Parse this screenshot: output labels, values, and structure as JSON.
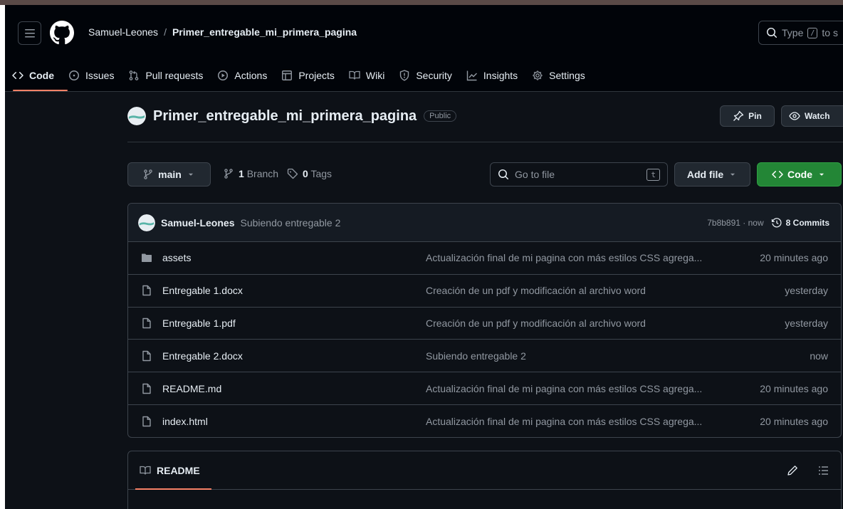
{
  "header": {
    "owner": "Samuel-Leones",
    "separator": "/",
    "repo": "Primer_entregable_mi_primera_pagina",
    "search_text": "Type",
    "search_kbd": "/",
    "search_suffix": "to s"
  },
  "nav": {
    "items": [
      {
        "label": "Code",
        "icon": "code-icon",
        "active": true
      },
      {
        "label": "Issues",
        "icon": "issue-icon"
      },
      {
        "label": "Pull requests",
        "icon": "pull-request-icon"
      },
      {
        "label": "Actions",
        "icon": "play-icon"
      },
      {
        "label": "Projects",
        "icon": "table-icon"
      },
      {
        "label": "Wiki",
        "icon": "book-icon"
      },
      {
        "label": "Security",
        "icon": "shield-icon"
      },
      {
        "label": "Insights",
        "icon": "graph-icon"
      },
      {
        "label": "Settings",
        "icon": "gear-icon"
      }
    ]
  },
  "repo": {
    "name": "Primer_entregable_mi_primera_pagina",
    "visibility": "Public",
    "pin_label": "Pin",
    "watch_label": "Watch"
  },
  "toolbar": {
    "branch": "main",
    "branch_count": "1",
    "branch_label": "Branch",
    "tag_count": "0",
    "tag_label": "Tags",
    "goto_placeholder": "Go to file",
    "goto_kbd": "t",
    "add_file_label": "Add file",
    "code_label": "Code"
  },
  "commit": {
    "author": "Samuel-Leones",
    "message": "Subiendo entregable 2",
    "hash_time": "7b8b891 · now",
    "commits_label": "8 Commits"
  },
  "files": [
    {
      "name": "assets",
      "type": "folder",
      "message": "Actualización final de mi pagina con más estilos CSS agrega...",
      "time": "20 minutes ago"
    },
    {
      "name": "Entregable 1.docx",
      "type": "file",
      "message": "Creación de un pdf y modificación al archivo word",
      "time": "yesterday"
    },
    {
      "name": "Entregable 1.pdf",
      "type": "file",
      "message": "Creación de un pdf y modificación al archivo word",
      "time": "yesterday"
    },
    {
      "name": "Entregable 2.docx",
      "type": "file",
      "message": "Subiendo entregable 2",
      "time": "now"
    },
    {
      "name": "README.md",
      "type": "file",
      "message": "Actualización final de mi pagina con más estilos CSS agrega...",
      "time": "20 minutes ago"
    },
    {
      "name": "index.html",
      "type": "file",
      "message": "Actualización final de mi pagina con más estilos CSS agrega...",
      "time": "20 minutes ago"
    }
  ],
  "readme": {
    "title": "README"
  },
  "colors": {
    "background": "#0d1117",
    "header_bg": "#010409",
    "accent_green": "#238636",
    "active_underline": "#f78166",
    "muted_text": "#9198a1"
  }
}
